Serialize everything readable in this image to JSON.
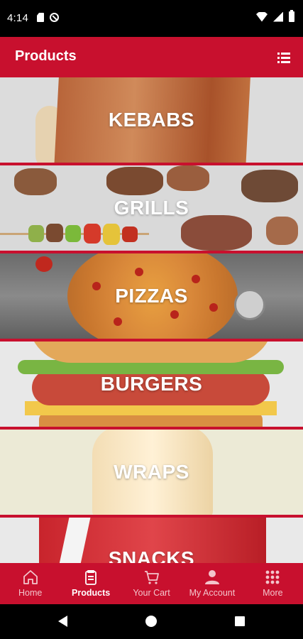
{
  "status_bar": {
    "time": "4:14"
  },
  "app_bar": {
    "title": "Products"
  },
  "categories": [
    {
      "label": "KEBABS"
    },
    {
      "label": "GRILLS"
    },
    {
      "label": "PIZZAS"
    },
    {
      "label": "BURGERS"
    },
    {
      "label": "WRAPS"
    },
    {
      "label": "SNACKS"
    }
  ],
  "bottom_nav": {
    "active": "Products",
    "items": [
      {
        "label": "Home",
        "icon": "home-icon"
      },
      {
        "label": "Products",
        "icon": "products-icon"
      },
      {
        "label": "Your Cart",
        "icon": "cart-icon"
      },
      {
        "label": "My Account",
        "icon": "account-icon"
      },
      {
        "label": "More",
        "icon": "grid-icon"
      }
    ]
  },
  "colors": {
    "brand": "#c8102e",
    "inactive_nav": "#f3c4cb"
  }
}
